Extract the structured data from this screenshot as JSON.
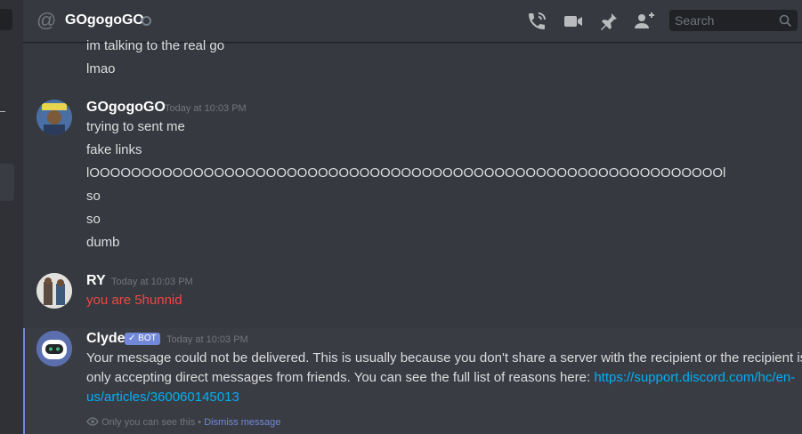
{
  "header": {
    "title": "GOgogoGO",
    "search_placeholder": "Search"
  },
  "messages": {
    "prev_lines": [
      "im talking to the real go",
      "lmao"
    ],
    "group1": {
      "username": "GOgogoGO",
      "timestamp": "Today at 10:03 PM",
      "lines": [
        "trying to sent me",
        "fake links",
        "lOOOOOOOOOOOOOOOOOOOOOOOOOOOOOOOOOOOOOOOOOOOOOOOOOOOOOOOOOOOOOl",
        "so",
        "so",
        "dumb"
      ]
    },
    "group2": {
      "username": "RY",
      "timestamp": "Today at 10:03 PM",
      "text": "you are 5hunnid",
      "text_color": "#f04747"
    },
    "clyde": {
      "username": "Clyde",
      "bot_tag": "✓ BOT",
      "timestamp": "Today at 10:03 PM",
      "text_line1": "Your message could not be delivered. This is usually because you don't share a server with the recipient or the recipient is",
      "text_line2": "only accepting direct messages from friends. You can see the full list of reasons here: ",
      "link_line2": "https://support.discord.com/hc/en-",
      "link_line3": "us/articles/360060145013",
      "notice_text": "Only you can see this",
      "notice_sep": " • ",
      "dismiss_label": "Dismiss message"
    }
  },
  "colors": {
    "accent": "#7289da",
    "link": "#00b0f4",
    "background": "#36393f"
  },
  "icons": [
    "at-icon",
    "status-offline-icon",
    "call-icon",
    "video-icon",
    "pin-icon",
    "add-friend-icon",
    "search-icon",
    "eye-icon"
  ]
}
